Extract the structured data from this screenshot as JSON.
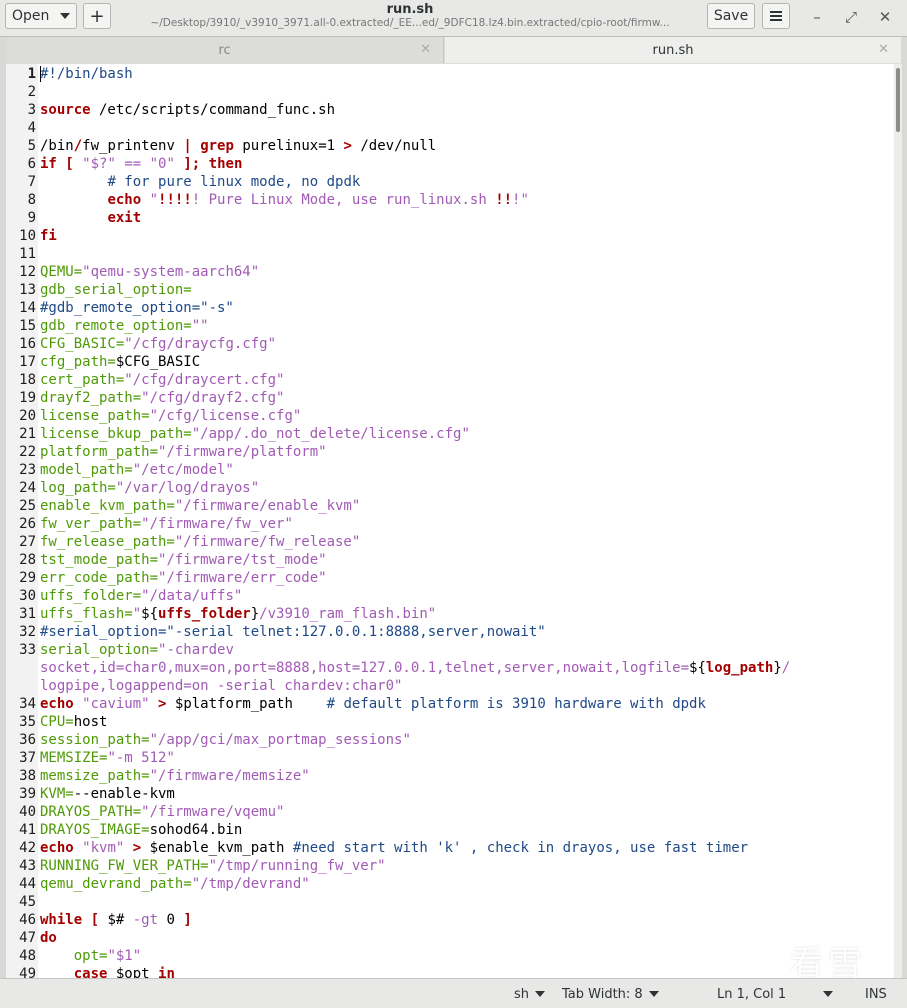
{
  "header": {
    "open_label": "Open",
    "new_tab_label": "+",
    "title": "run.sh",
    "subtitle": "~/Desktop/3910/_v3910_3971.all-0.extracted/_EE...ed/_9DFC18.lz4.bin.extracted/cpio-root/firmw...",
    "save_label": "Save",
    "minimize_label": "–",
    "maximize_label": "⤢",
    "close_label": "✕"
  },
  "tabs": [
    {
      "label": "rc",
      "active": false
    },
    {
      "label": "run.sh",
      "active": true
    }
  ],
  "tab_close_label": "✕",
  "editor": {
    "lines": [
      {
        "n": "1",
        "html": "<span class='cm'>#!/bin/bash</span>"
      },
      {
        "n": "2",
        "html": ""
      },
      {
        "n": "3",
        "html": "<span class='kw'>source</span> /etc/scripts/command_func.sh"
      },
      {
        "n": "4",
        "html": ""
      },
      {
        "n": "5",
        "html": "/bin<span class='bs'>/</span>fw_printenv <span class='op'>|</span> <span class='kw'>grep</span> purelinux=1 <span class='op'>&gt;</span> /dev/null"
      },
      {
        "n": "6",
        "html": "<span class='kw'>if</span> <span class='kw'>[</span> <span class='st'>\"$?\"</span> <span class='st'>==</span> <span class='st'>\"0\"</span> <span class='kw'>];</span> <span class='kw'>then</span>"
      },
      {
        "n": "7",
        "html": "        <span class='cm'># for pure linux mode, no dpdk</span>"
      },
      {
        "n": "8",
        "html": "        <span class='kw'>echo</span> <span class='st'>\"<span class='kw'>!!!!</span>! Pure Linux Mode, use run_linux.sh <span class='kw'>!!</span>!\"</span>"
      },
      {
        "n": "9",
        "html": "        <span class='kw'>exit</span>"
      },
      {
        "n": "10",
        "html": "<span class='kw'>fi</span>"
      },
      {
        "n": "11",
        "html": ""
      },
      {
        "n": "12",
        "html": "<span class='vr'>QEMU=</span><span class='st'>\"qemu-system-aarch64\"</span>"
      },
      {
        "n": "13",
        "html": "<span class='vr'>gdb_serial_option=</span>"
      },
      {
        "n": "14",
        "html": "<span class='cm'>#gdb_remote_option=\"-s\"</span>"
      },
      {
        "n": "15",
        "html": "<span class='vr'>gdb_remote_option=</span><span class='st'>\"\"</span>"
      },
      {
        "n": "16",
        "html": "<span class='vr'>CFG_BASIC=</span><span class='st'>\"/cfg/draycfg.cfg\"</span>"
      },
      {
        "n": "17",
        "html": "<span class='vr'>cfg_path=</span>$CFG_BASIC"
      },
      {
        "n": "18",
        "html": "<span class='vr'>cert_path=</span><span class='st'>\"/cfg/draycert.cfg\"</span>"
      },
      {
        "n": "19",
        "html": "<span class='vr'>drayf2_path=</span><span class='st'>\"/cfg/drayf2.cfg\"</span>"
      },
      {
        "n": "20",
        "html": "<span class='vr'>license_path=</span><span class='st'>\"/cfg/license.cfg\"</span>"
      },
      {
        "n": "21",
        "html": "<span class='vr'>license_bkup_path=</span><span class='st'>\"/app/.do_not_delete/license.cfg\"</span>"
      },
      {
        "n": "22",
        "html": "<span class='vr'>platform_path=</span><span class='st'>\"/firmware/platform\"</span>"
      },
      {
        "n": "23",
        "html": "<span class='vr'>model_path=</span><span class='st'>\"/etc/model\"</span>"
      },
      {
        "n": "24",
        "html": "<span class='vr'>log_path=</span><span class='st'>\"/var/log/drayos\"</span>"
      },
      {
        "n": "25",
        "html": "<span class='vr'>enable_kvm_path=</span><span class='st'>\"/firmware/enable_kvm\"</span>"
      },
      {
        "n": "26",
        "html": "<span class='vr'>fw_ver_path=</span><span class='st'>\"/firmware/fw_ver\"</span>"
      },
      {
        "n": "27",
        "html": "<span class='vr'>fw_release_path=</span><span class='st'>\"/firmware/fw_release\"</span>"
      },
      {
        "n": "28",
        "html": "<span class='vr'>tst_mode_path=</span><span class='st'>\"/firmware/tst_mode\"</span>"
      },
      {
        "n": "29",
        "html": "<span class='vr'>err_code_path=</span><span class='st'>\"/firmware/err_code\"</span>"
      },
      {
        "n": "30",
        "html": "<span class='vr'>uffs_folder=</span><span class='st'>\"/data/uffs\"</span>"
      },
      {
        "n": "31",
        "html": "<span class='vr'>uffs_flash=</span><span class='st'>\"</span>${<span class='kw'>uffs_folder</span>}<span class='st'>/v3910_ram_flash.bin\"</span>"
      },
      {
        "n": "32",
        "html": "<span class='cm'>#serial_option=\"-serial telnet:127.0.0.1:8888,server,nowait\"</span>"
      },
      {
        "n": "33",
        "html": "<span class='vr'>serial_option=</span><span class='st'>\"-chardev</span>"
      },
      {
        "n": "",
        "html": "<span class='st'>socket,id=char0,mux=on,port=8888,host=127.0.0.1,telnet,server,nowait,logfile=</span>${<span class='kw'>log_path</span>}<span class='st'>/</span>"
      },
      {
        "n": "",
        "html": "<span class='st'>logpipe,logappend=on -serial chardev:char0\"</span>"
      },
      {
        "n": "34",
        "html": "<span class='kw'>echo</span> <span class='st'>\"cavium\"</span> <span class='op'>&gt;</span> $platform_path    <span class='cm'># default platform is 3910 hardware with dpdk</span>"
      },
      {
        "n": "35",
        "html": "<span class='vr'>CPU=</span>host"
      },
      {
        "n": "36",
        "html": "<span class='vr'>session_path=</span><span class='st'>\"/app/gci/max_portmap_sessions\"</span>"
      },
      {
        "n": "37",
        "html": "<span class='vr'>MEMSIZE=</span><span class='st'>\"-m 512\"</span>"
      },
      {
        "n": "38",
        "html": "<span class='vr'>memsize_path=</span><span class='st'>\"/firmware/memsize\"</span>"
      },
      {
        "n": "39",
        "html": "<span class='vr'>KVM=</span>--enable-kvm"
      },
      {
        "n": "40",
        "html": "<span class='vr'>DRAYOS_PATH=</span><span class='st'>\"/firmware/vqemu\"</span>"
      },
      {
        "n": "41",
        "html": "<span class='vr'>DRAYOS_IMAGE=</span>sohod64.bin"
      },
      {
        "n": "42",
        "html": "<span class='kw'>echo</span> <span class='st'>\"kvm\"</span> <span class='op'>&gt;</span> $enable_kvm_path <span class='cm'>#need start with 'k' , check in drayos, use fast timer</span>"
      },
      {
        "n": "43",
        "html": "<span class='vr'>RUNNING_FW_VER_PATH=</span><span class='st'>\"/tmp/running_fw_ver\"</span>"
      },
      {
        "n": "44",
        "html": "<span class='vr'>qemu_devrand_path=</span><span class='st'>\"/tmp/devrand\"</span>"
      },
      {
        "n": "45",
        "html": ""
      },
      {
        "n": "46",
        "html": "<span class='kw'>while</span> <span class='kw'>[</span> $# <span class='st'>-gt</span> 0 <span class='kw'>]</span>"
      },
      {
        "n": "47",
        "html": "<span class='kw'>do</span>"
      },
      {
        "n": "48",
        "html": "    <span class='vr'>opt=</span><span class='st'>\"$1\"</span>"
      },
      {
        "n": "49",
        "html": "    <span class='kw'>case</span> $opt <span class='kw'>in</span>"
      }
    ]
  },
  "status": {
    "language": "sh",
    "tab_width": "Tab Width: 8",
    "cursor": "Ln 1, Col 1",
    "mode": "INS"
  },
  "watermark": {
    "text": "看雪"
  }
}
